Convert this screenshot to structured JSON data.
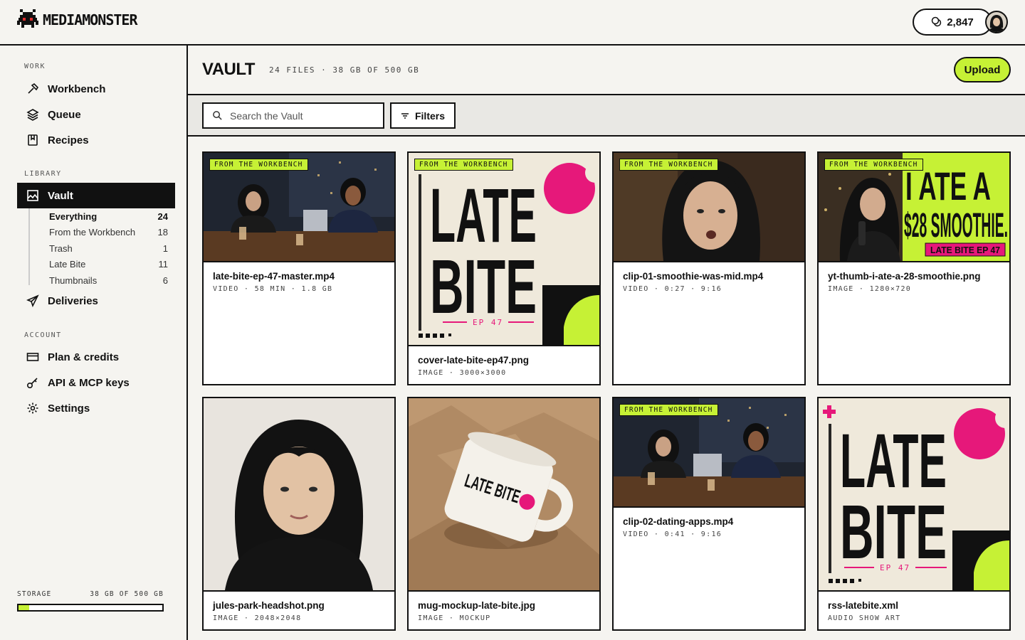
{
  "app": {
    "logo_text": "MEDIAMONSTER",
    "credits": "2,847",
    "accent": "#c6f135"
  },
  "sidebar": {
    "work_label": "WORK",
    "work_items": [
      {
        "label": "Workbench",
        "icon": "hammer-icon"
      },
      {
        "label": "Queue",
        "icon": "layers-icon"
      },
      {
        "label": "Recipes",
        "icon": "book-icon"
      }
    ],
    "library_label": "LIBRARY",
    "vault_label": "Vault",
    "vault_sub": [
      {
        "label": "Everything",
        "count": "24"
      },
      {
        "label": "From the Workbench",
        "count": "18"
      },
      {
        "label": "Trash",
        "count": "1"
      },
      {
        "label": "Late Bite",
        "count": "11"
      },
      {
        "label": "Thumbnails",
        "count": "6"
      }
    ],
    "deliveries_label": "Deliveries",
    "account_label": "ACCOUNT",
    "account_items": [
      {
        "label": "Plan & credits",
        "icon": "card-icon"
      },
      {
        "label": "API & MCP keys",
        "icon": "key-icon"
      },
      {
        "label": "Settings",
        "icon": "gear-icon"
      }
    ],
    "storage": {
      "label": "STORAGE",
      "value": "38 GB OF 500 GB",
      "used_fraction": 0.076
    }
  },
  "main": {
    "title": "VAULT",
    "meta": "24 FILES · 38 GB OF 500 GB",
    "upload_label": "Upload",
    "search_placeholder": "Search the Vault",
    "filters_label": "Filters",
    "badge_text": "FROM THE WORKBENCH",
    "cards": [
      {
        "name": "late-bite-ep-47-master.mp4",
        "meta": "VIDEO · 58 MIN · 1.8 GB",
        "badge": true,
        "thumb": "podcast-scene"
      },
      {
        "name": "cover-late-bite-ep47.png",
        "meta": "IMAGE · 3000×3000",
        "badge": true,
        "thumb": "cover-art",
        "cover_text": [
          "LATE",
          "BITE"
        ],
        "cover_ep": "EP 47"
      },
      {
        "name": "clip-01-smoothie-was-mid.mp4",
        "meta": "VIDEO · 0:27 · 9:16",
        "badge": true,
        "thumb": "host-closeup"
      },
      {
        "name": "yt-thumb-i-ate-a-28-smoothie.png",
        "meta": "IMAGE · 1280×720",
        "badge": true,
        "thumb": "yt-thumbnail",
        "thumb_text": [
          "I ATE A",
          "$28 SMOOTHIE."
        ],
        "thumb_tag": "LATE BITE EP 47"
      },
      {
        "name": "jules-park-headshot.png",
        "meta": "IMAGE · 2048×2048",
        "badge": false,
        "thumb": "headshot"
      },
      {
        "name": "mug-mockup-late-bite.jpg",
        "meta": "IMAGE · MOCKUP",
        "badge": false,
        "thumb": "mug-mockup",
        "mug_text": "LATE BITE"
      },
      {
        "name": "clip-02-dating-apps.mp4",
        "meta": "VIDEO · 0:41 · 9:16",
        "badge": true,
        "thumb": "podcast-scene"
      },
      {
        "name": "rss-latebite.xml",
        "meta": "AUDIO SHOW ART",
        "badge": false,
        "thumb": "cover-art",
        "cover_text": [
          "LATE",
          "BITE"
        ],
        "cover_ep": "EP 47"
      }
    ]
  }
}
